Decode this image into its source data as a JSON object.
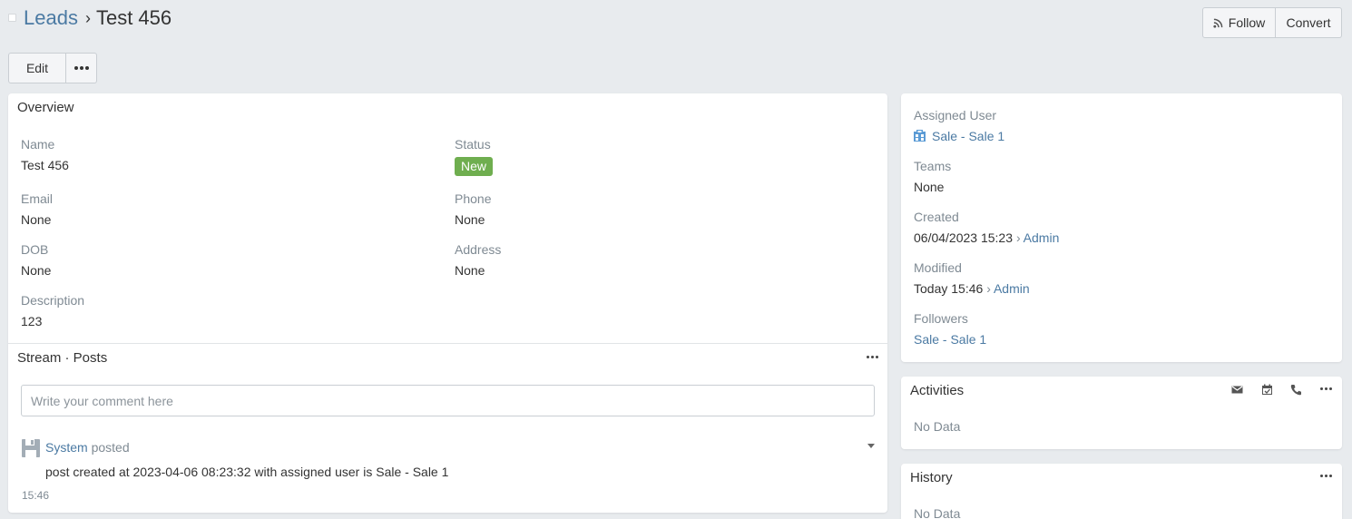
{
  "header": {
    "breadcrumb_parent": "Leads",
    "breadcrumb_separator": "›",
    "breadcrumb_current": "Test 456",
    "follow_label": "Follow",
    "convert_label": "Convert"
  },
  "actions": {
    "edit_label": "Edit"
  },
  "overview": {
    "title": "Overview",
    "fields": {
      "name_label": "Name",
      "name_value": "Test 456",
      "status_label": "Status",
      "status_value": "New",
      "email_label": "Email",
      "email_value": "None",
      "phone_label": "Phone",
      "phone_value": "None",
      "dob_label": "DOB",
      "dob_value": "None",
      "address_label": "Address",
      "address_value": "None",
      "description_label": "Description",
      "description_value": "123"
    }
  },
  "stream": {
    "title": "Stream · Posts",
    "comment_placeholder": "Write your comment here",
    "post": {
      "author": "System",
      "verb": "posted",
      "text": "post created at 2023-04-06 08:23:32 with assigned user is Sale - Sale 1",
      "time": "15:46"
    }
  },
  "side": {
    "assigned_user_label": "Assigned User",
    "assigned_user_value": "Sale - Sale 1",
    "teams_label": "Teams",
    "teams_value": "None",
    "created_label": "Created",
    "created_date": "06/04/2023 15:23",
    "created_arrow": "›",
    "created_by": "Admin",
    "modified_label": "Modified",
    "modified_date": "Today 15:46",
    "modified_arrow": "›",
    "modified_by": "Admin",
    "followers_label": "Followers",
    "followers_value": "Sale - Sale 1"
  },
  "activities": {
    "title": "Activities",
    "empty_text": "No Data",
    "icons": [
      "envelope-icon",
      "calendar-icon",
      "phone-icon"
    ]
  },
  "history": {
    "title": "History",
    "empty_text": "No Data"
  },
  "colors": {
    "link": "#4b7aa3",
    "status_new": "#6fae4f",
    "background": "#e8ebee"
  }
}
